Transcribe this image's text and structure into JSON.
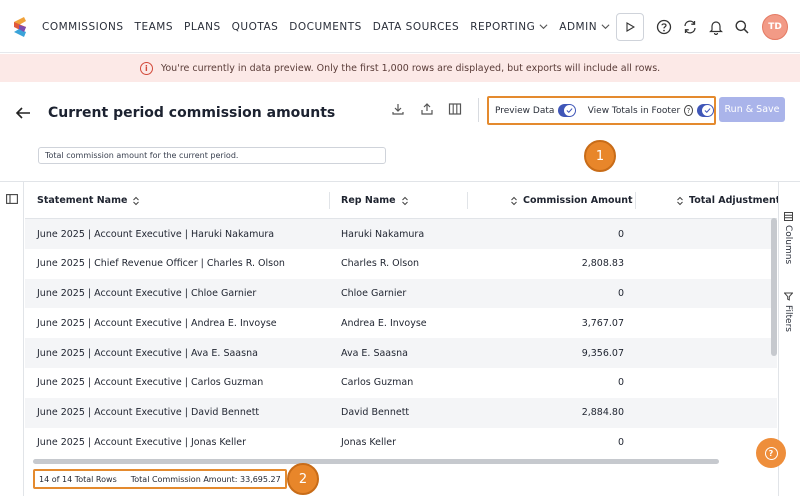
{
  "nav": {
    "items": [
      "COMMISSIONS",
      "TEAMS",
      "PLANS",
      "QUOTAS",
      "DOCUMENTS",
      "DATA SOURCES"
    ],
    "dropdowns": [
      "REPORTING",
      "ADMIN"
    ],
    "avatar_initials": "TD"
  },
  "banner": {
    "icon": "i",
    "text": "You're currently in data preview. Only the first 1,000 rows are displayed, but exports will include all rows."
  },
  "header": {
    "title": "Current period commission amounts",
    "description": "Total commission amount for the current period.",
    "preview_label": "Preview Data",
    "totals_label": "View Totals in Footer",
    "help_glyph": "?",
    "run_label": "Run & Save"
  },
  "callouts": {
    "one": "1",
    "two": "2"
  },
  "table": {
    "columns": [
      "Statement Name",
      "Rep Name",
      "Commission Amount",
      "Total Adjustment"
    ],
    "rows": [
      {
        "statement": "June 2025 | Account Executive | Haruki Nakamura",
        "rep": "Haruki Nakamura",
        "amount": "0"
      },
      {
        "statement": "June 2025 | Chief Revenue Officer | Charles R. Olson",
        "rep": "Charles R. Olson",
        "amount": "2,808.83"
      },
      {
        "statement": "June 2025 | Account Executive | Chloe Garnier",
        "rep": "Chloe Garnier",
        "amount": "0"
      },
      {
        "statement": "June 2025 | Account Executive | Andrea E. Invoyse",
        "rep": "Andrea E. Invoyse",
        "amount": "3,767.07"
      },
      {
        "statement": "June 2025 | Account Executive | Ava E. Saasna",
        "rep": "Ava E. Saasna",
        "amount": "9,356.07"
      },
      {
        "statement": "June 2025 | Account Executive | Carlos Guzman",
        "rep": "Carlos Guzman",
        "amount": "0"
      },
      {
        "statement": "June 2025 | Account Executive | David Bennett",
        "rep": "David Bennett",
        "amount": "2,884.80"
      },
      {
        "statement": "June 2025 | Account Executive | Jonas Keller",
        "rep": "Jonas Keller",
        "amount": "0"
      }
    ]
  },
  "side_tabs": {
    "columns": "Columns",
    "filters": "Filters"
  },
  "footer": {
    "rows": "14 of 14 Total Rows",
    "total": "Total Commission Amount: 33,695.27"
  },
  "colors": {
    "accent": "#3f56b8",
    "run_button": "#aab4ea",
    "callout": "#e8862a",
    "banner_bg": "#fce9e7",
    "avatar": "#f29a86"
  }
}
